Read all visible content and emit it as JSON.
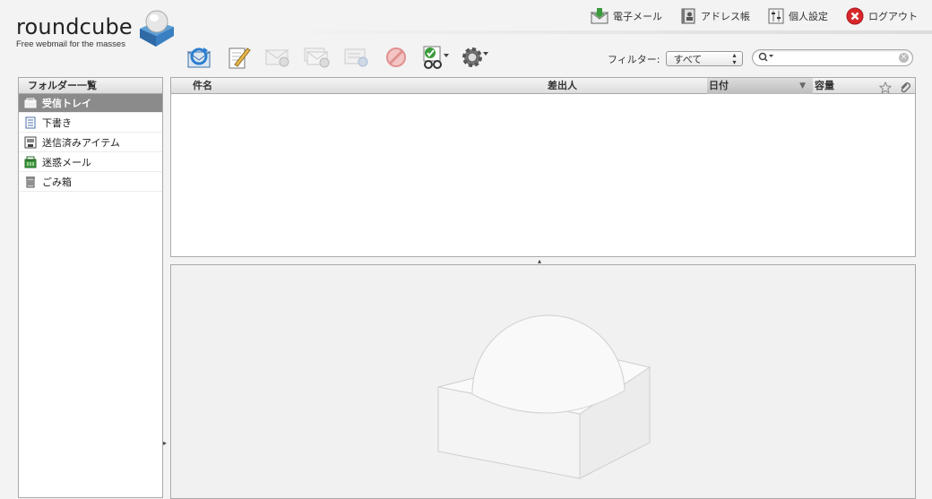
{
  "logo": {
    "wordmark": "roundcube",
    "tagline": "Free webmail for the masses"
  },
  "topnav": [
    {
      "label": "電子メール",
      "icon": "mail-download-icon"
    },
    {
      "label": "アドレス帳",
      "icon": "address-book-icon"
    },
    {
      "label": "個人設定",
      "icon": "settings-panel-icon"
    },
    {
      "label": "ログアウト",
      "icon": "logout-icon"
    }
  ],
  "toolbar": [
    {
      "name": "check-mail-button",
      "icon": "refresh-mail-icon",
      "enabled": true
    },
    {
      "name": "compose-button",
      "icon": "compose-icon",
      "enabled": true
    },
    {
      "name": "reply-button",
      "icon": "reply-icon",
      "enabled": false
    },
    {
      "name": "reply-all-button",
      "icon": "reply-all-icon",
      "enabled": false
    },
    {
      "name": "forward-button",
      "icon": "forward-icon",
      "enabled": false
    },
    {
      "name": "delete-button",
      "icon": "delete-icon",
      "enabled": false
    },
    {
      "name": "mark-button",
      "icon": "mark-icon",
      "enabled": true
    },
    {
      "name": "more-button",
      "icon": "gear-icon",
      "enabled": true
    }
  ],
  "filter": {
    "label": "フィルター:",
    "selected": "すべて"
  },
  "search": {
    "placeholder": "",
    "value": ""
  },
  "folders": {
    "title": "フォルダー一覧",
    "items": [
      {
        "label": "受信トレイ",
        "icon": "inbox-icon",
        "selected": true
      },
      {
        "label": "下書き",
        "icon": "drafts-icon",
        "selected": false
      },
      {
        "label": "送信済みアイテム",
        "icon": "sent-icon",
        "selected": false
      },
      {
        "label": "迷惑メール",
        "icon": "junk-icon",
        "selected": false
      },
      {
        "label": "ごみ箱",
        "icon": "trash-icon",
        "selected": false
      }
    ]
  },
  "messagelist": {
    "columns": {
      "subject": "件名",
      "from": "差出人",
      "date": "日付",
      "size": "容量"
    },
    "rows": []
  },
  "colors": {
    "selected_folder_bg": "#8b8b8b",
    "accent_blue": "#3a7fc1",
    "logout_red": "#d9262b"
  }
}
